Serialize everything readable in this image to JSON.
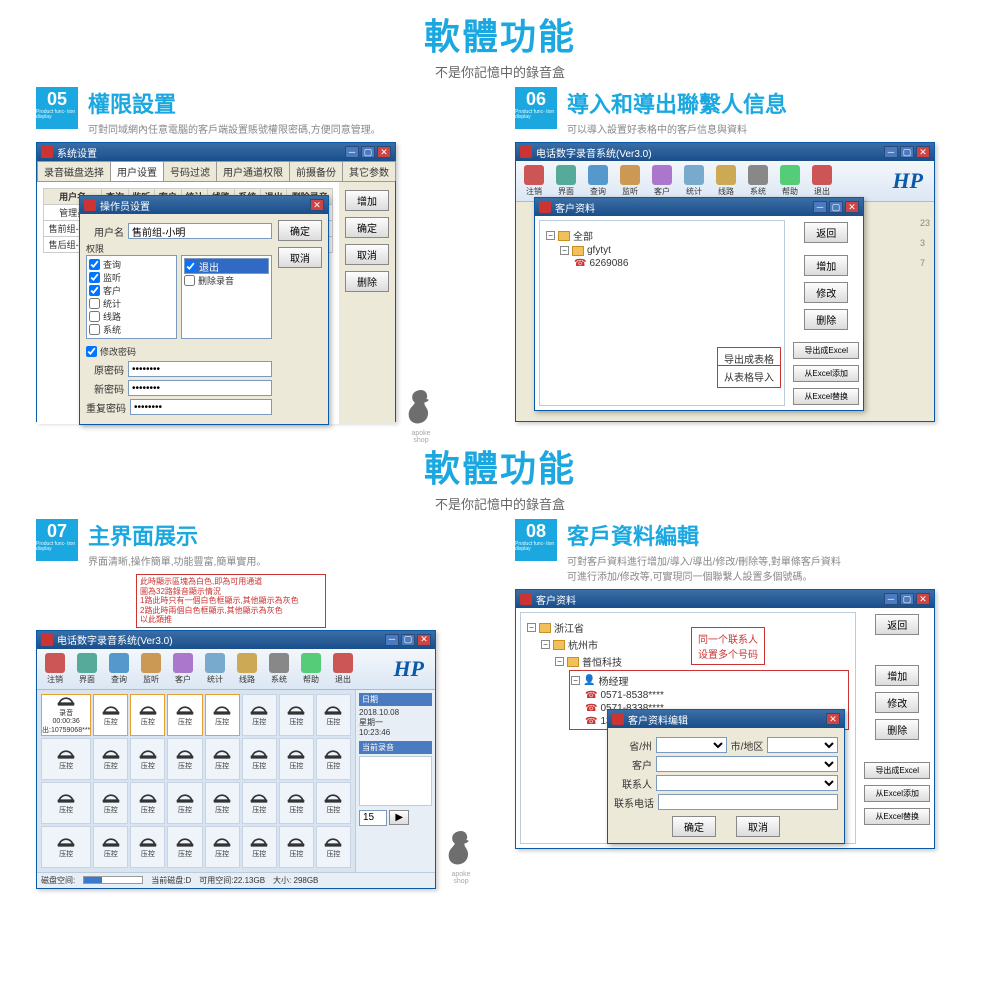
{
  "hero": {
    "title": "軟體功能",
    "subtitle": "不是你記憶中的錄音盒"
  },
  "f05": {
    "num": "05",
    "badge_sub": "Product func-\ntion display",
    "title": "權限設置",
    "desc": "可對同域網內任意電腦的客戶端設置賬號權限密碼,方便同意管理。",
    "win_title": "系统设置",
    "tabs": [
      "录音磁盘选择",
      "用户设置",
      "号码过滤",
      "用户通道权限",
      "前摄备份",
      "其它参数"
    ],
    "cols": [
      "用户名",
      "查询",
      "监听",
      "客户",
      "统计",
      "线路",
      "系统",
      "退出",
      "删除录音"
    ],
    "rows": [
      [
        "管理员",
        "√",
        "√",
        "√",
        "√",
        "√",
        "√",
        "√",
        "√"
      ],
      [
        "售前组-小静",
        "√",
        "",
        "√",
        "",
        "",
        "",
        "√",
        ""
      ],
      [
        "售后组-小东",
        "√",
        "",
        "",
        "√",
        "",
        "",
        "√",
        ""
      ]
    ],
    "btn_add": "增加",
    "btn_ok": "确定",
    "btn_cancel": "取消",
    "btn_del": "删除",
    "sub_title": "操作员设置",
    "lbl_user": "用户名",
    "val_user": "售前组-小明",
    "grp_perm": "权限",
    "perm_left": [
      "查询",
      "监听",
      "客户",
      "统计",
      "线路",
      "系统"
    ],
    "perm_left_checked": [
      true,
      true,
      true,
      false,
      false,
      false
    ],
    "perm_right": [
      "退出",
      "删除录音"
    ],
    "chk_pwd": "修改密码",
    "lbl_oldpwd": "原密码",
    "lbl_newpwd": "新密码",
    "lbl_reppwd": "重复密码",
    "pwd_mask": "********"
  },
  "f06": {
    "num": "06",
    "title": "導入和導出聯繫人信息",
    "desc": "可以導入設置好表格中的客戶信息與資料",
    "win_title": "电话数字录音系统(Ver3.0)",
    "toolbar": [
      "注销",
      "界面",
      "查询",
      "监听",
      "客户",
      "统计",
      "线路",
      "系统",
      "帮助",
      "退出"
    ],
    "sub_title": "客户资料",
    "tree_root": "全部",
    "tree_folder": "gfytyt",
    "tree_leaf": "6269086",
    "side_nums": [
      "23",
      "3",
      "7"
    ],
    "btn_back": "返回",
    "btn_add": "增加",
    "btn_mod": "修改",
    "btn_del": "删除",
    "btn_exp_excel": "导出成Excel",
    "btn_imp_excel": "从Excel添加",
    "btn_rep_excel": "从Excel替换",
    "callout_exp": "导出成表格",
    "callout_imp": "从表格导入"
  },
  "f07": {
    "num": "07",
    "title": "主界面展示",
    "desc": "界面清晰,操作簡單,功能豐富,簡單實用。",
    "win_title": "电话数字录音系统(Ver3.0)",
    "annot": [
      "此時顯示區塊為白色,即為可用通道",
      "圖為32路錄音顯示情況",
      "1路此時只有一個白色框顯示,其他顯示為灰色",
      "2路此時兩個白色框顯示,其他顯示為灰色",
      "以此類推"
    ],
    "cell_idle": "压控",
    "cell_rec": "录音",
    "cell_out": "出",
    "cell_code": "00:00:36",
    "cell_num": "出:10759068***",
    "side_date": "2018.10.08",
    "side_day": "星期一",
    "side_time": "10:23:46",
    "side_lbl_date": "日期",
    "side_lbl_rec": "当前录音",
    "status_disk": "磁盘空间:",
    "status_cur": "当前磁盘:D",
    "status_free": "可用空间:22.13GB",
    "status_size": "大小: 298GB",
    "bar_val": "15"
  },
  "f08": {
    "num": "08",
    "title": "客戶資料編輯",
    "desc": "可對客戶資料進行增加/導入/導出/修改/刪除等,對單條客戶資料\n可進行添加/修改等,可實現同一個聯繫人設置多個號碼。",
    "sub_title": "客户资料",
    "tree_prov": "浙江省",
    "tree_city": "杭州市",
    "tree_corp": "普恒科技",
    "tree_dept": "杨经理",
    "phones": [
      "0571-8538****",
      "0571-8338****",
      "137381#****"
    ],
    "callout": "同一个联系人\n设置多个号码",
    "edit_title": "客户资料编辑",
    "lbl_prov": "省/州",
    "lbl_city": "市/地区",
    "lbl_corp": "客户",
    "lbl_contact": "联系人",
    "lbl_phone": "联系电话",
    "btn_ok": "确定",
    "btn_cancel": "取消",
    "btn_back": "返回",
    "btn_add": "增加",
    "btn_mod": "修改",
    "btn_del": "删除",
    "btn_exp_excel": "导出成Excel",
    "btn_imp_excel": "从Excel添加",
    "btn_rep_excel": "从Excel替换"
  },
  "watermark": "apoke shop"
}
